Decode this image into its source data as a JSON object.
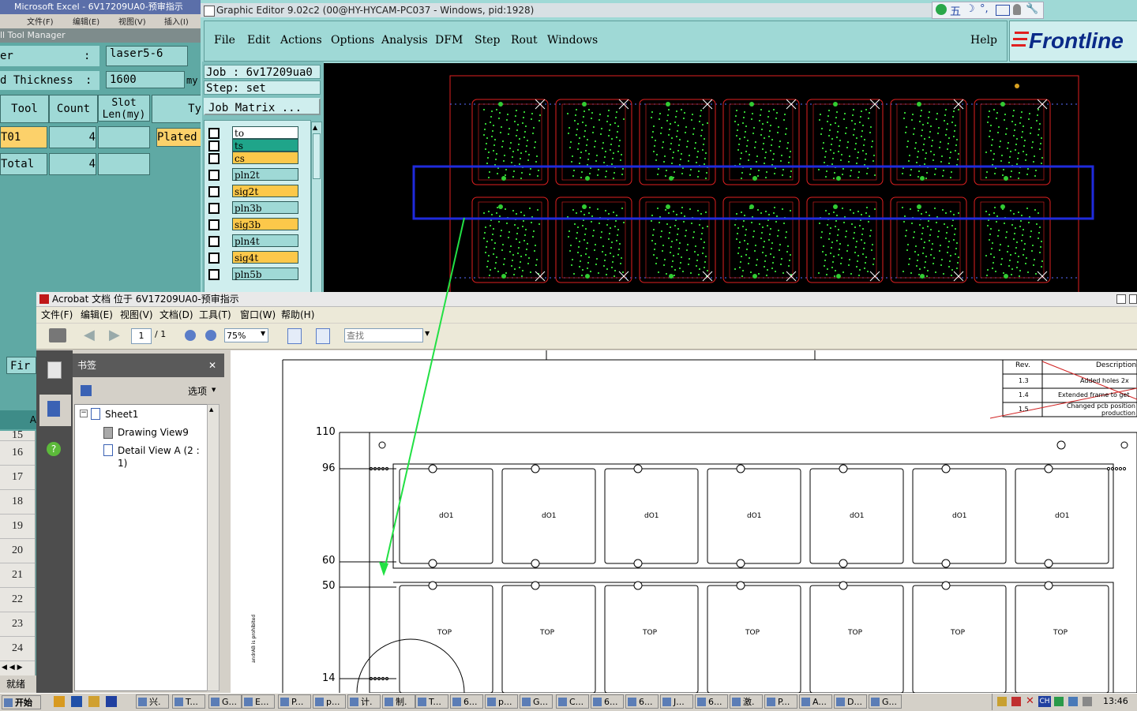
{
  "excel": {
    "title": "Microsoft Excel - 6V17209UA0-预审指示",
    "menu": [
      "文件(F)",
      "编辑(E)",
      "视图(V)",
      "插入(I)"
    ],
    "status": "就绪",
    "row_numbers": [
      "15",
      "16",
      "17",
      "18",
      "19",
      "20",
      "21",
      "22",
      "23",
      "24"
    ],
    "fir_label": "Fir",
    "a_label": "A"
  },
  "tool_manager": {
    "title": "ll Tool Manager",
    "layer_label": "er",
    "layer_sep": ":",
    "layer_value": "laser5-6",
    "thickness_label": "d Thickness",
    "thickness_sep": ":",
    "thickness_value": "1600",
    "thickness_unit": "my",
    "columns": [
      "Tool",
      "Count",
      "Slot\nLen(my)",
      "Ty"
    ],
    "rows": [
      {
        "tool": "T01",
        "count": "4",
        "slot": "",
        "type": "Plated"
      },
      {
        "tool": "Total",
        "count": "4",
        "slot": "",
        "type": ""
      }
    ]
  },
  "graphic_editor": {
    "title": "Graphic Editor 9.02c2 (00@HY-HYCAM-PC037 - Windows, pid:1928)",
    "menu": [
      "File",
      "Edit",
      "Actions",
      "Options",
      "Analysis",
      "DFM",
      "Step",
      "Rout",
      "Windows"
    ],
    "help": "Help",
    "logo": "Frontline",
    "job_label": "Job : 6v17209ua0",
    "step_label": "Step: set",
    "job_matrix": "Job Matrix ...",
    "layers": [
      {
        "name": "to",
        "color": "#ffffff"
      },
      {
        "name": "ts",
        "color": "#1fa58a"
      },
      {
        "name": "cs",
        "color": "#fcc84a"
      },
      {
        "name": "pln2t",
        "color": "#9fd9d6"
      },
      {
        "name": "sig2t",
        "color": "#fcc84a"
      },
      {
        "name": "pln3b",
        "color": "#9fd9d6"
      },
      {
        "name": "sig3b",
        "color": "#fcc84a"
      },
      {
        "name": "pln4t",
        "color": "#9fd9d6"
      },
      {
        "name": "sig4t",
        "color": "#fcc84a"
      },
      {
        "name": "pln5b",
        "color": "#9fd9d6"
      }
    ]
  },
  "acrobat": {
    "title": "Acrobat 文档 位于 6V17209UA0-预审指示",
    "menu": [
      "文件(F)",
      "编辑(E)",
      "视图(V)",
      "文档(D)",
      "工具(T)",
      "窗口(W)",
      "帮助(H)"
    ],
    "page_current": "1",
    "page_total": "/ 1",
    "zoom": "75%",
    "search_placeholder": "查找",
    "bookmarks_title": "书签",
    "options_label": "选项",
    "tree": [
      "Sheet1",
      "Drawing View9",
      "Detail View A (2 : 1)"
    ]
  },
  "drawing": {
    "revision_header": [
      "Rev.",
      "Description"
    ],
    "revisions": [
      {
        "rev": "1.3",
        "desc": "Added holes 2x"
      },
      {
        "rev": "1.4",
        "desc": "Extended frame to get"
      },
      {
        "rev": "1.5",
        "desc": "Changed pcb position production"
      }
    ],
    "dimensions": [
      "110",
      "96",
      "60",
      "50",
      "14"
    ],
    "top_row_label": "dO1",
    "bottom_row_label": "TOP",
    "side_note": "andrAB is prohibited"
  },
  "taskbar": {
    "start": "开始",
    "items": [
      "兴.",
      "T...",
      "G...",
      "E...",
      "P...",
      "p...",
      "计.",
      "制.",
      "T...",
      "6...",
      "p...",
      "G...",
      "C...",
      "6...",
      "6...",
      "J...",
      "6...",
      "激.",
      "P...",
      "A...",
      "D...",
      "G..."
    ],
    "clock": "13:46",
    "lang": "CH"
  },
  "colors": {
    "cad_outline": "#e02020",
    "cad_pads": "#33cc33",
    "selection": "#1f2bdc",
    "arrow": "#22e044"
  }
}
